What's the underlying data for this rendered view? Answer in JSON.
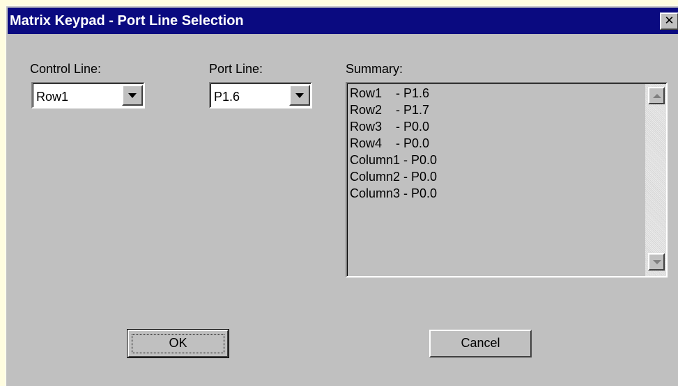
{
  "window": {
    "title": "Matrix Keypad - Port Line Selection",
    "close_glyph": "✕",
    "titlebar_color": "#0a0a80",
    "face_color": "#c0c0c0"
  },
  "control_line": {
    "label": "Control Line:",
    "value": "Row1"
  },
  "port_line": {
    "label": "Port Line:",
    "value": "P1.6"
  },
  "summary": {
    "label": "Summary:",
    "lines": [
      "Row1    - P1.6",
      "Row2    - P1.7",
      "Row3    - P0.0",
      "Row4    - P0.0",
      "Column1 - P0.0",
      "Column2 - P0.0",
      "Column3 - P0.0"
    ]
  },
  "buttons": {
    "ok_label": "OK",
    "cancel_label": "Cancel"
  },
  "icons": {
    "dropdown": "chevron-down-icon",
    "scroll_up": "arrow-up-icon",
    "scroll_down": "arrow-down-icon",
    "close": "close-icon"
  }
}
